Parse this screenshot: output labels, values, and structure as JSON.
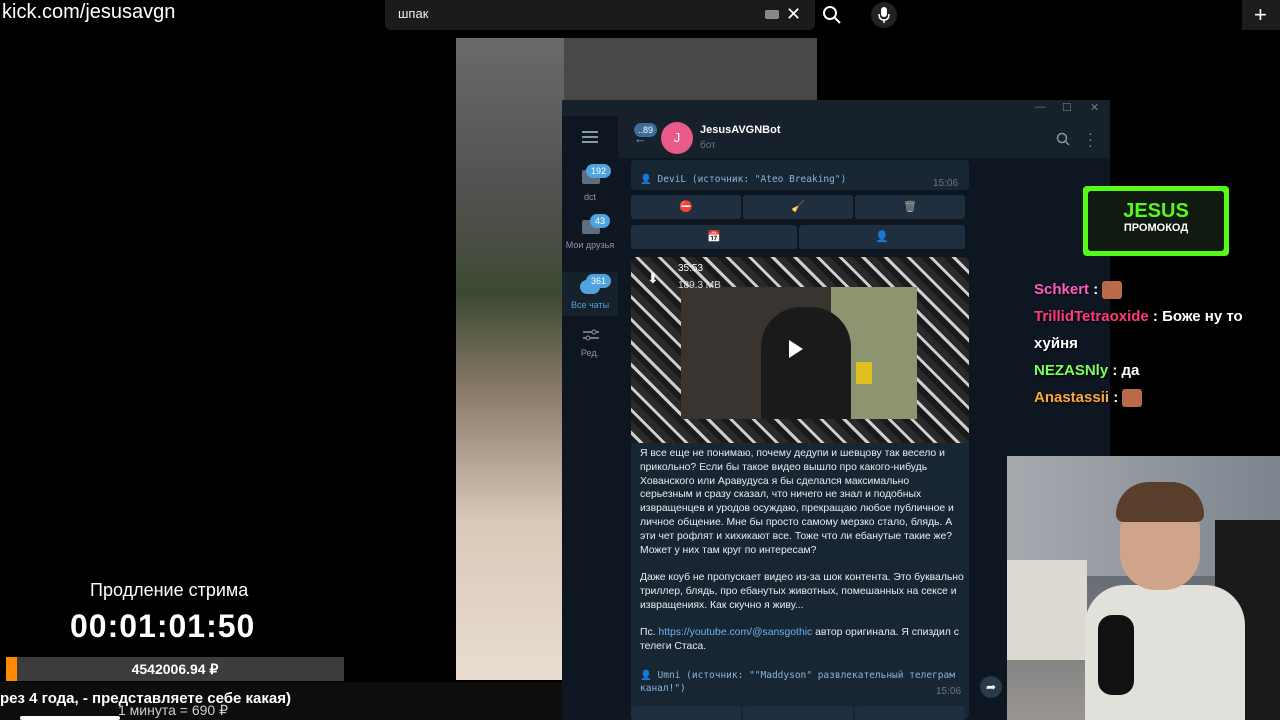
{
  "browser": {
    "url": "kick.com/jesusavgn",
    "search_query": "шпак"
  },
  "telegram": {
    "back_badge": "..89",
    "avatar_letter": "J",
    "chat_name": "JesusAVGNBot",
    "chat_sub": "бот",
    "sidebar": [
      {
        "label": "dct",
        "badge": "192"
      },
      {
        "label": "Мои друзья",
        "badge": "43"
      },
      {
        "label": "Все чаты",
        "badge": "361"
      },
      {
        "label": "Ред.",
        "badge": ""
      }
    ],
    "msg1_caption": "👤 DeviL (источник: \"Ateo Breaking\")",
    "msg1_time": "15:06",
    "video_duration": "35:53",
    "video_size": "189.3 MB",
    "paragraph1": "Я все еще не понимаю, почему дедупи и шевцову так весело и прикольно? Если бы такое видео вышло про какого-нибудь Хованского или Аравудуса я бы сделался максимально серьезным и сразу сказал, что ничего не знал и подобных извращенцев и уродов осуждаю, прекращаю любое публичное и личное общение. Мне бы просто самому мерзко стало, блядь. А эти чет рофлят и хихикают все. Тоже что ли ебанутые такие же? Может у них там круг по интересам?",
    "paragraph2": "Даже коуб не пропускает видео из-за шок контента. Это буквально триллер, блядь, про ебанутых животных, помешанных на сексе и извращениях. Как скучно я живу...",
    "ps_prefix": "Пс. ",
    "ps_link": "https://youtube.com/@sansgothic",
    "ps_suffix": " автор оригинала. Я спиздил с телеги Стаса.",
    "msg2_caption": "👤 Umni (источник: \"\"Maddyson\" развлекательный телеграм канал!\")",
    "msg2_time": "15:06"
  },
  "promo": {
    "title": "JESUS",
    "subtitle": "ПРОМОКОД"
  },
  "chat": [
    {
      "user": "Schkert",
      "color": "#ff5ac8",
      "text": "",
      "emote": true
    },
    {
      "user": "TrillidTetraoxide",
      "color": "#ff3c78",
      "text": "Боже ну то хуйня",
      "emote": false
    },
    {
      "user": "NEZASNly",
      "color": "#7cff5a",
      "text": "да",
      "emote": false
    },
    {
      "user": "Anastassii",
      "color": "#ffa83c",
      "text": "",
      "emote": true
    }
  ],
  "subathon": {
    "title": "Продление стрима",
    "timer": "00:01:01:50",
    "amount": "4542006.94 ₽",
    "ticker": "рез 4 года, - представляете себе какая)",
    "rate": "1 минута = 690 ₽"
  }
}
